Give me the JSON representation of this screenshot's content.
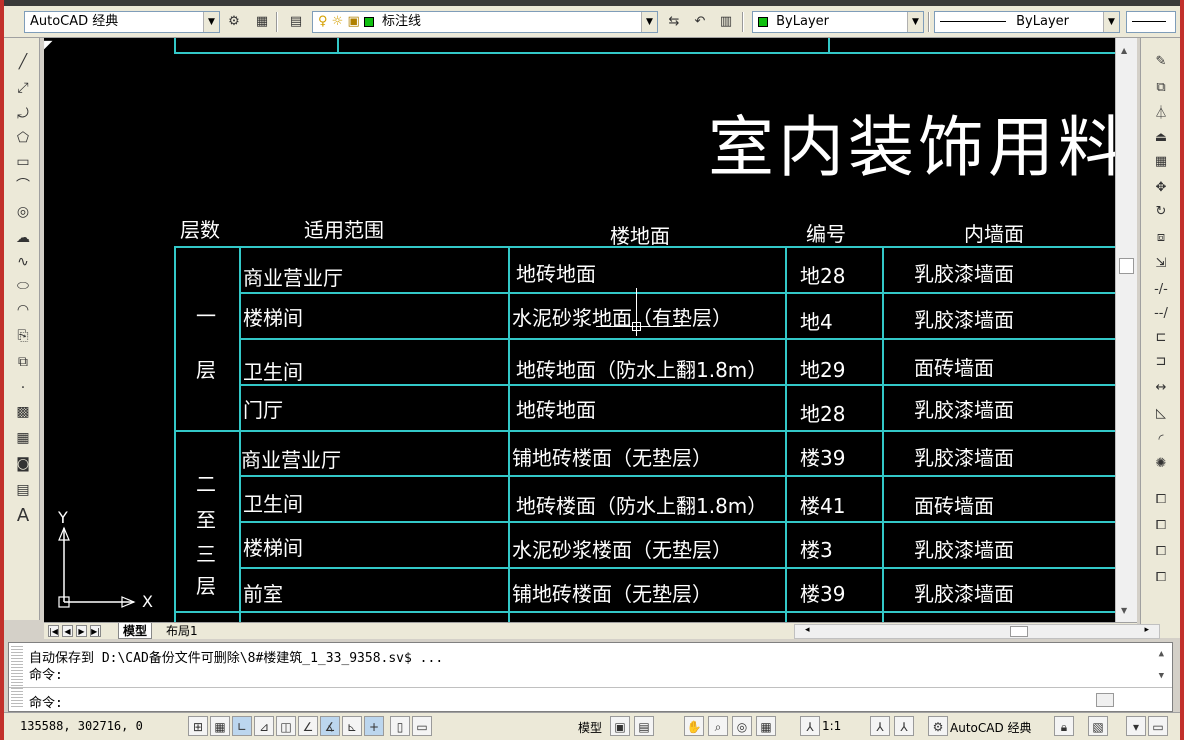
{
  "toolbar": {
    "workspace": "AutoCAD 经典",
    "layer": "标注线",
    "color": "ByLayer",
    "linetype": "ByLayer",
    "color_swatch": "#10c010"
  },
  "drawing": {
    "title": "室内装饰用料",
    "headers": [
      "层数",
      "适用范围",
      "楼地面",
      "编号",
      "内墙面"
    ],
    "floor_groups": [
      {
        "chars": [
          "一",
          "层"
        ]
      },
      {
        "chars": [
          "二",
          "至",
          "三",
          "层"
        ]
      }
    ],
    "rows": [
      [
        "商业营业厅",
        "地砖地面",
        "地28",
        "乳胶漆墙面"
      ],
      [
        "楼梯间",
        "水泥砂浆地面（有垫层）",
        "地4",
        "乳胶漆墙面"
      ],
      [
        "卫生间",
        "地砖地面（防水上翻1.8m）",
        "地29",
        "面砖墙面"
      ],
      [
        "门厅",
        "地砖地面",
        "地28",
        "乳胶漆墙面"
      ],
      [
        "商业营业厅",
        "铺地砖楼面（无垫层）",
        "楼39",
        "乳胶漆墙面"
      ],
      [
        "卫生间",
        "地砖楼面（防水上翻1.8m）",
        "楼41",
        "面砖墙面"
      ],
      [
        "楼梯间",
        "水泥砂浆楼面（无垫层）",
        "楼3",
        "乳胶漆墙面"
      ],
      [
        "前室",
        "铺地砖楼面（无垫层）",
        "楼39",
        "乳胶漆墙面"
      ]
    ],
    "ucs_x": "X",
    "ucs_y": "Y",
    "line_color": "#33c8c8"
  },
  "tabs": {
    "model": "模型",
    "layout1": "布局1"
  },
  "command": {
    "history1": "自动保存到 D:\\CAD备份文件可删除\\8#楼建筑_1_33_9358.sv$ ...",
    "history2": "命令:",
    "prompt": "命令:"
  },
  "status": {
    "coords": "135588, 302716, 0",
    "model": "模型",
    "scale": "1:1",
    "workspace": "AutoCAD 经典"
  }
}
